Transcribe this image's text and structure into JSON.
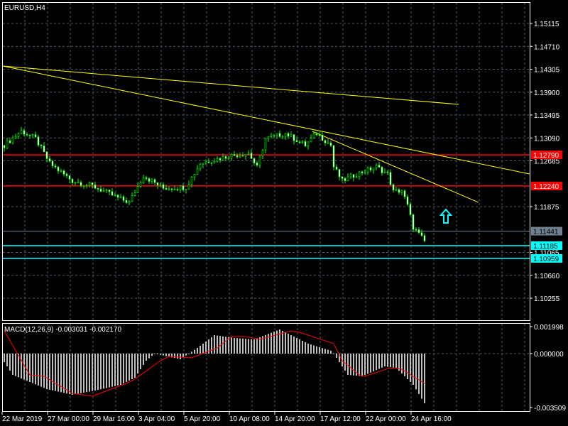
{
  "chart_data": {
    "type": "candlestick",
    "title": "EURUSD,H4",
    "colors": {
      "bull": "#00ff00",
      "bear": "#ffffff",
      "grid": "#4a5a6a",
      "axis": "#ffffff",
      "trend": "#ffff00",
      "support": "#00ffff",
      "resistance": "#ff0000",
      "bid": "#708090",
      "macd_hist": "#c0c0c0",
      "macd_signal": "#ff0000"
    },
    "price_axis": {
      "ticks": [
        "1.15115",
        "1.14710",
        "1.14305",
        "1.13900",
        "1.13495",
        "1.13090",
        "1.12685",
        "1.11875",
        "1.11065",
        "1.10660",
        "1.10255"
      ],
      "range": [
        1.099,
        1.1555
      ]
    },
    "time_axis": {
      "labels": [
        "22 Mar 2019",
        "27 Mar 00:00",
        "29 Mar 16:00",
        "3 Apr 04:00",
        "5 Apr 20:00",
        "10 Apr 08:00",
        "14 Apr 20:00",
        "17 Apr 12:00",
        "22 Apr 00:00",
        "24 Apr 16:00"
      ],
      "bars_per_label": 16
    },
    "price_keypoints": [
      [
        0,
        1.1296
      ],
      [
        6,
        1.1321
      ],
      [
        11,
        1.1308
      ],
      [
        16,
        1.1264
      ],
      [
        24,
        1.1233
      ],
      [
        31,
        1.1224
      ],
      [
        41,
        1.1201
      ],
      [
        44,
        1.1195
      ],
      [
        49,
        1.1242
      ],
      [
        56,
        1.122
      ],
      [
        64,
        1.1222
      ],
      [
        69,
        1.1264
      ],
      [
        79,
        1.1277
      ],
      [
        86,
        1.1282
      ],
      [
        89,
        1.1257
      ],
      [
        92,
        1.1308
      ],
      [
        99,
        1.1317
      ],
      [
        106,
        1.1296
      ],
      [
        110,
        1.1317
      ],
      [
        115,
        1.1296
      ],
      [
        116,
        1.1258
      ],
      [
        119,
        1.1233
      ],
      [
        124,
        1.1245
      ],
      [
        131,
        1.1258
      ],
      [
        135,
        1.1245
      ],
      [
        137,
        1.1214
      ],
      [
        140,
        1.1216
      ],
      [
        142,
        1.1189
      ],
      [
        144,
        1.1151
      ],
      [
        148,
        1.1126
      ]
    ],
    "levels": [
      {
        "name": "resistance-1",
        "price": 1.1279,
        "label": "1.12790",
        "kind": "resistance"
      },
      {
        "name": "resistance-2",
        "price": 1.1224,
        "label": "1.12240",
        "kind": "resistance"
      },
      {
        "name": "bid",
        "price": 1.11441,
        "label": "1.11441",
        "kind": "bid"
      },
      {
        "name": "support-1",
        "price": 1.11185,
        "label": "1.11185",
        "kind": "support"
      },
      {
        "name": "support-2",
        "price": 1.10959,
        "label": "1.10959",
        "kind": "support"
      }
    ],
    "trendlines": [
      {
        "name": "trendline-long",
        "from": [
          -0.5,
          1.14362
        ],
        "to": [
          160,
          1.13683
        ]
      },
      {
        "name": "trendline-mid",
        "from": [
          -0.5,
          1.14362
        ],
        "to": [
          185,
          1.12453
        ]
      },
      {
        "name": "trendline-short",
        "from": [
          108.5,
          1.13206
        ],
        "to": [
          167,
          1.1195
        ]
      }
    ],
    "arrow": {
      "bar": 155.5,
      "price": 1.11699,
      "direction": "up"
    },
    "macd": {
      "label": "MACD(12,26,9) -0.003031 -0.002170",
      "ticks": [
        "0.001998",
        "0.000000",
        "-0.003509"
      ],
      "hist_keypoints": [
        [
          0,
          -0.0006
        ],
        [
          3,
          -0.0015
        ],
        [
          15,
          -0.0025
        ],
        [
          24,
          -0.0029
        ],
        [
          32,
          -0.0026
        ],
        [
          41,
          -0.0022
        ],
        [
          46,
          -0.0017
        ],
        [
          50,
          -0.0005
        ],
        [
          53,
          0
        ],
        [
          62,
          -0.0004
        ],
        [
          68,
          0.0004
        ],
        [
          74,
          0.0013
        ],
        [
          81,
          0.0011
        ],
        [
          88,
          0.001
        ],
        [
          97,
          0.0017
        ],
        [
          107,
          0.0007
        ],
        [
          115,
          0.0002
        ],
        [
          117,
          -0.0003
        ],
        [
          121,
          -0.0015
        ],
        [
          126,
          -0.0016
        ],
        [
          134,
          -0.0009
        ],
        [
          138,
          -0.001
        ],
        [
          144,
          -0.0022
        ],
        [
          148,
          -0.0035
        ]
      ],
      "signal_keypoints": [
        [
          0,
          0.0016
        ],
        [
          9,
          -0.0015
        ],
        [
          14,
          -0.0016
        ],
        [
          24,
          -0.0028
        ],
        [
          31,
          -0.003
        ],
        [
          43,
          -0.0021
        ],
        [
          46,
          -0.0018
        ],
        [
          55,
          -0.0005
        ],
        [
          58,
          -0.0002
        ],
        [
          66,
          -0.0003
        ],
        [
          75,
          0.0004
        ],
        [
          80,
          0.0012
        ],
        [
          85,
          0.0012
        ],
        [
          90,
          0.001
        ],
        [
          101,
          0.0016
        ],
        [
          104,
          0.0015
        ],
        [
          110,
          0.0011
        ],
        [
          116,
          0.0007
        ],
        [
          119,
          -0.0005
        ],
        [
          125,
          -0.0015
        ],
        [
          127,
          -0.0016
        ],
        [
          136,
          -0.001
        ],
        [
          140,
          -0.0011
        ],
        [
          148,
          -0.0021
        ]
      ]
    }
  }
}
